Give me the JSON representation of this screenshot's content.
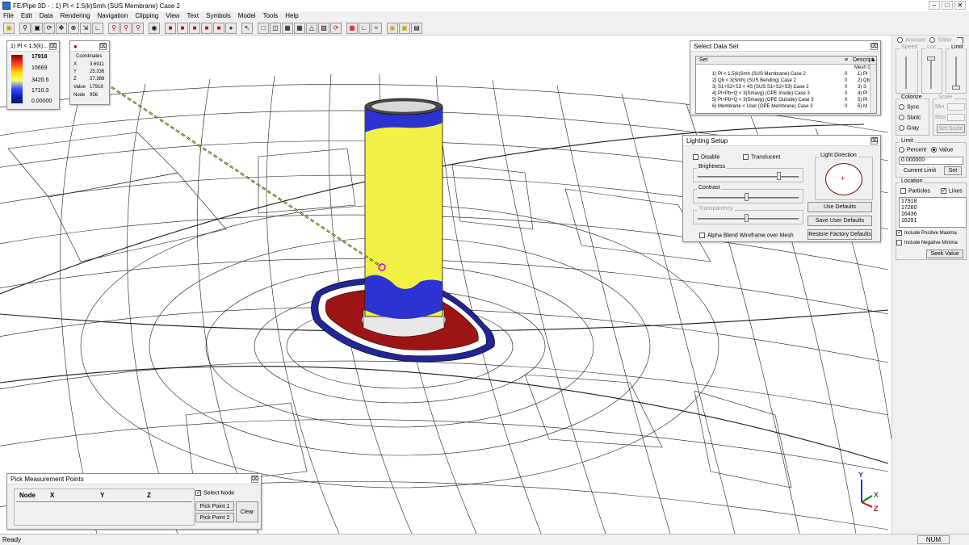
{
  "title": "FE/Pipe 3D - : 1) Pl < 1.5(k)Smh (SUS Membrane) Case 2",
  "window_buttons": [
    "–",
    "□",
    "✕"
  ],
  "menu": [
    "File",
    "Edit",
    "Data",
    "Rendering",
    "Navigation",
    "Clipping",
    "View",
    "Text",
    "Symbols",
    "Model",
    "Tools",
    "Help"
  ],
  "legend": {
    "title": "1) Pl < 1.5(k)...",
    "values": [
      "17918",
      "10669",
      "3420.5",
      "1710.3",
      "0.00000"
    ]
  },
  "coordinates": {
    "title": "Coordinates",
    "rows": [
      {
        "label": "X",
        "value": "3.6911"
      },
      {
        "label": "Y",
        "value": "25.336"
      },
      {
        "label": "Z",
        "value": "27.388"
      },
      {
        "label": "Value",
        "value": "17918"
      },
      {
        "label": "Node",
        "value": "956"
      }
    ]
  },
  "dataset": {
    "title": "Select Data Set",
    "col_set": "Set",
    "col_desc": "Descript",
    "subheader": "Mesh Gr",
    "rows": [
      {
        "set": "1) Pl < 1.5(k)Smh (SUS Membrane) Case 2",
        "n": "0",
        "d": "1) Pl"
      },
      {
        "set": "2) Qb < 3(Smh) (SUS Bending) Case 2",
        "n": "0",
        "d": "2) Qb"
      },
      {
        "set": "3) S1+S2+S3 < 4S (SUS S1+S2+S3) Case 2",
        "n": "0",
        "d": "3) S"
      },
      {
        "set": "4) Pl+Pb+Q < 3(Smavg) (OPE Inside) Case 3",
        "n": "0",
        "d": "4) Pl"
      },
      {
        "set": "5) Pl+Pb+Q < 3(Smavg) (OPE Outside) Case 3",
        "n": "0",
        "d": "5) Pl"
      },
      {
        "set": "6) Membrane < User (OPE Membrane) Case 3",
        "n": "0",
        "d": "6) M"
      }
    ]
  },
  "lighting": {
    "title": "Lighting Setup",
    "disable": "Disable",
    "translucent": "Translucent",
    "brightness": "Brightness",
    "contrast": "Contrast",
    "transparency": "Transparency",
    "brightness_level": 0.82,
    "contrast_level": 0.48,
    "transparency_level": 0.48,
    "light_direction": "Light Direction",
    "alpha_blend": "Alpha Blend Wireframe over Mesh",
    "use_defaults": "Use Defaults",
    "save_user": "Save User Defaults",
    "restore_factory": "Restore Factory Defaults"
  },
  "pick": {
    "title": "Pick Measurement Points",
    "cols": [
      "Node",
      "X",
      "Y",
      "Z"
    ],
    "select_node": "Select Node",
    "pick1": "Pick Point 1",
    "pick2": "Pick Point 2",
    "clear": "Clear"
  },
  "right": {
    "animate": "Animate",
    "slider": "Slider",
    "speed": "Speed",
    "loc": "Loc",
    "limit_col": "Limit",
    "colorize": "Colorize",
    "sync": "Sync",
    "static": "Static",
    "gray": "Gray",
    "scale": "Scale",
    "min": "Min",
    "max": "Max",
    "set_scale": "Set Scale",
    "limit": "Limit",
    "percent": "Percent",
    "value": "Value",
    "limit_value": "0.000000",
    "current_limit": "Current Limit",
    "set": "Set",
    "location": "Location",
    "particles": "Particles",
    "lines": "Lines",
    "nodes": [
      "17918",
      "17260",
      "16436",
      "16291"
    ],
    "include_pos": "Include Positive Maxima",
    "include_neg": "Include Negative Minima",
    "seek": "Seek Value"
  },
  "axes": {
    "x": "X",
    "y": "Y",
    "z": "Z"
  },
  "status": {
    "left": "Ready",
    "num": "NUM"
  },
  "colors": {
    "yellow": "#f2f044",
    "blue": "#2c33d0",
    "red": "#9c1414",
    "wire": "#1a1a1a"
  }
}
